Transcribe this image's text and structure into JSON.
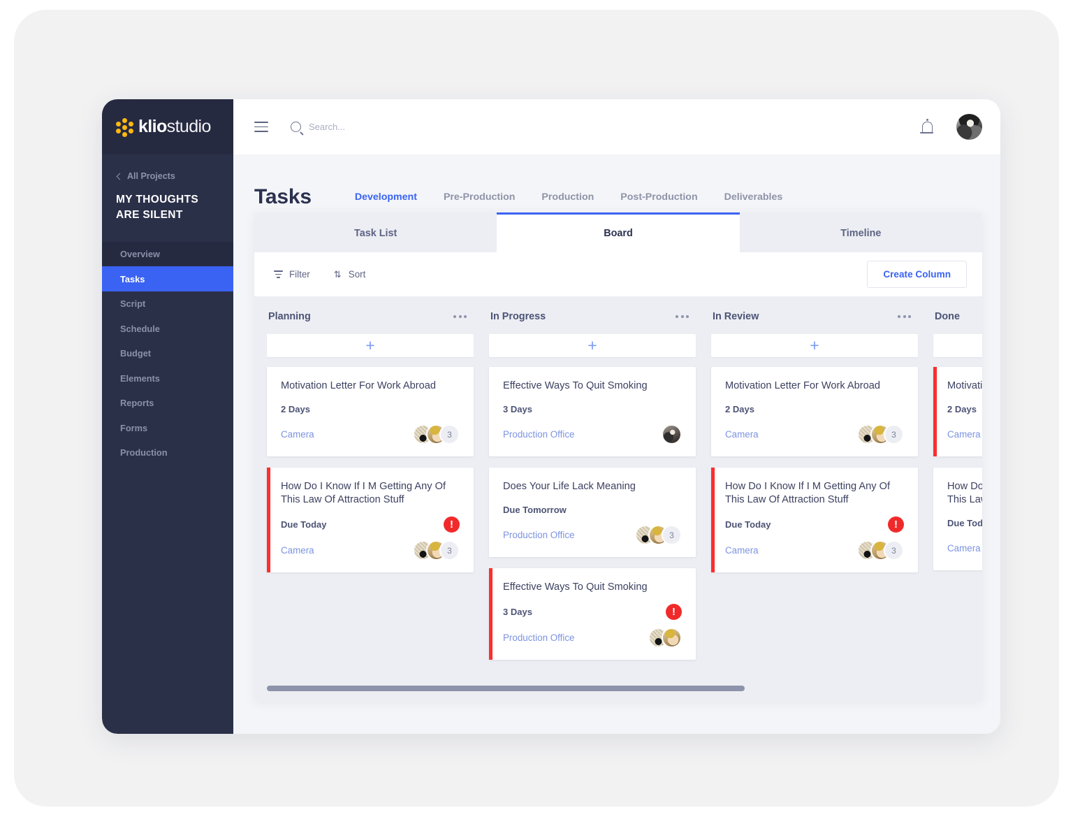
{
  "brand": {
    "name_bold": "klio",
    "name_light": "studio",
    "icon": "flower-dots-icon",
    "accent": "#fdb913"
  },
  "sidebar": {
    "back_label": "All Projects",
    "project_title": "MY THOUGHTS ARE SILENT",
    "items": [
      {
        "label": "Overview",
        "state": "shaded"
      },
      {
        "label": "Tasks",
        "state": "active"
      },
      {
        "label": "Script",
        "state": "normal"
      },
      {
        "label": "Schedule",
        "state": "normal"
      },
      {
        "label": "Budget",
        "state": "normal"
      },
      {
        "label": "Elements",
        "state": "normal"
      },
      {
        "label": "Reports",
        "state": "normal"
      },
      {
        "label": "Forms",
        "state": "normal"
      },
      {
        "label": "Production",
        "state": "normal"
      }
    ],
    "bg": "#2b3049",
    "active_color": "#3a63f3"
  },
  "topbar": {
    "menu_icon": "hamburger-icon",
    "search_icon": "search-icon",
    "search_placeholder": "Search...",
    "search_value": "",
    "bell_icon": "bell-icon",
    "avatar": "user-avatar"
  },
  "header": {
    "title": "Tasks",
    "section_tabs": [
      {
        "label": "Development",
        "active": true
      },
      {
        "label": "Pre-Production",
        "active": false
      },
      {
        "label": "Production",
        "active": false
      },
      {
        "label": "Post-Production",
        "active": false
      },
      {
        "label": "Deliverables",
        "active": false
      }
    ]
  },
  "view_tabs": [
    {
      "label": "Task List",
      "active": false
    },
    {
      "label": "Board",
      "active": true
    },
    {
      "label": "Timeline",
      "active": false
    }
  ],
  "toolbar": {
    "filter_label": "Filter",
    "sort_label": "Sort",
    "sort_glyph": "⇅",
    "create_column_label": "Create Column"
  },
  "board": {
    "add_glyph": "+",
    "columns": [
      {
        "title": "Planning",
        "cards": [
          {
            "title": "Motivation Letter For Work Abroad",
            "due": "2 Days",
            "tag": "Camera",
            "urgent": false,
            "alert": false,
            "avatars": [
              "av-a",
              "av-b"
            ],
            "extra_count": "3"
          },
          {
            "title": "How Do I Know If I M Getting Any Of This Law Of Attraction Stuff",
            "due": "Due Today",
            "tag": "Camera",
            "urgent": true,
            "alert": true,
            "avatars": [
              "av-a",
              "av-b"
            ],
            "extra_count": "3"
          }
        ]
      },
      {
        "title": "In Progress",
        "cards": [
          {
            "title": "Effective Ways To Quit Smoking",
            "due": "3 Days",
            "tag": "Production Office",
            "urgent": false,
            "alert": false,
            "avatars": [
              "av-c"
            ],
            "extra_count": ""
          },
          {
            "title": "Does Your Life Lack Meaning",
            "due": "Due Tomorrow",
            "tag": "Production Office",
            "urgent": false,
            "alert": false,
            "avatars": [
              "av-a",
              "av-b"
            ],
            "extra_count": "3"
          },
          {
            "title": "Effective Ways To Quit Smoking",
            "due": "3 Days",
            "tag": "Production Office",
            "urgent": true,
            "alert": true,
            "avatars": [
              "av-a",
              "av-b"
            ],
            "extra_count": ""
          }
        ]
      },
      {
        "title": "In Review",
        "cards": [
          {
            "title": "Motivation Letter For Work Abroad",
            "due": "2 Days",
            "tag": "Camera",
            "urgent": false,
            "alert": false,
            "avatars": [
              "av-a",
              "av-b"
            ],
            "extra_count": "3"
          },
          {
            "title": "How Do I Know If I M Getting Any Of This Law Of Attraction Stuff",
            "due": "Due Today",
            "tag": "Camera",
            "urgent": true,
            "alert": true,
            "avatars": [
              "av-a",
              "av-b"
            ],
            "extra_count": "3"
          }
        ]
      },
      {
        "title": "Done",
        "cards": [
          {
            "title": "Motivation Letter For Work Abroad",
            "due": "2 Days",
            "tag": "Camera",
            "urgent": true,
            "alert": false,
            "avatars": [],
            "extra_count": ""
          },
          {
            "title": "How Do I Know If I M Getting Any Of This Law Of Attraction Stuff",
            "due": "Due Today",
            "tag": "Camera",
            "urgent": false,
            "alert": false,
            "avatars": [],
            "extra_count": ""
          }
        ]
      }
    ]
  },
  "colors": {
    "accent_blue": "#3a63f3",
    "urgent_red": "#ff2d2d",
    "sidebar_dark": "#2b3049",
    "board_bg": "#eceef3"
  }
}
